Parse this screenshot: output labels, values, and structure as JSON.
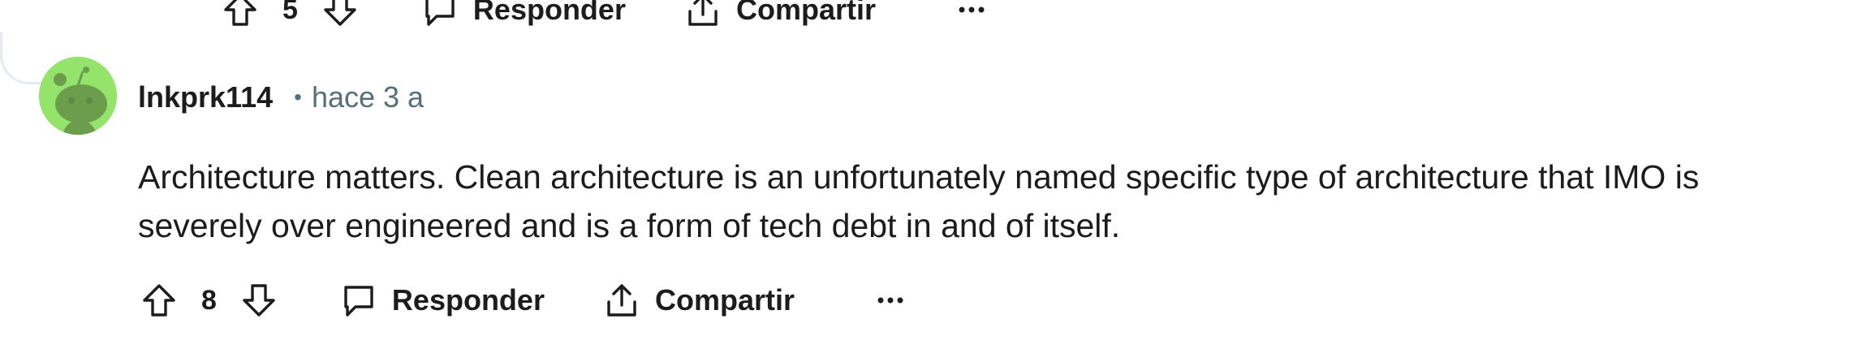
{
  "previous_comment": {
    "score": "5",
    "reply_label": "Responder",
    "share_label": "Compartir",
    "more_label": "..."
  },
  "comment": {
    "username": "lnkprk114",
    "separator": "•",
    "time": "hace 3 a",
    "body": "Architecture matters. Clean architecture is an unfortunately named specific type of architecture that IMO is severely over engineered and is a form of tech debt in and of itself.",
    "score": "8",
    "reply_label": "Responder",
    "share_label": "Compartir",
    "more_label": "..."
  },
  "colors": {
    "avatar_bg": "#94e36a",
    "avatar_snoo": "#6b9d4c",
    "meta_text": "#576f76",
    "text": "#1c1c1c"
  },
  "icons": [
    "upvote-icon",
    "downvote-icon",
    "comment-icon",
    "share-icon",
    "more-icon",
    "snoo-avatar-icon"
  ]
}
